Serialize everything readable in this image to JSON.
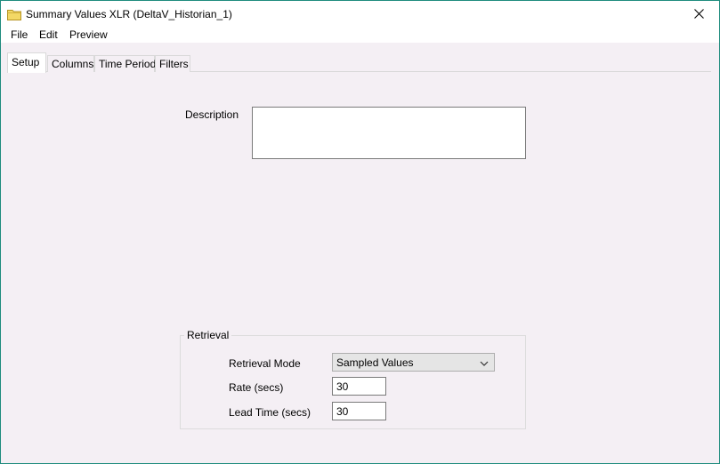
{
  "window": {
    "title": "Summary Values XLR (DeltaV_Historian_1)"
  },
  "menu": {
    "items": [
      "File",
      "Edit",
      "Preview"
    ]
  },
  "tabs": [
    "Setup",
    "Columns",
    "Time Period",
    "Filters"
  ],
  "active_tab": "Setup",
  "setup": {
    "description_label": "Description",
    "description_value": "",
    "retrieval": {
      "group_label": "Retrieval",
      "mode_label": "Retrieval Mode",
      "mode_value": "Sampled Values",
      "rate_label": "Rate (secs)",
      "rate_value": "30",
      "lead_time_label": "Lead Time (secs)",
      "lead_time_value": "30"
    }
  },
  "colors": {
    "client_background": "#f4eff4",
    "window_border": "#1f8c7e",
    "folder_icon": "#e8c94a"
  }
}
